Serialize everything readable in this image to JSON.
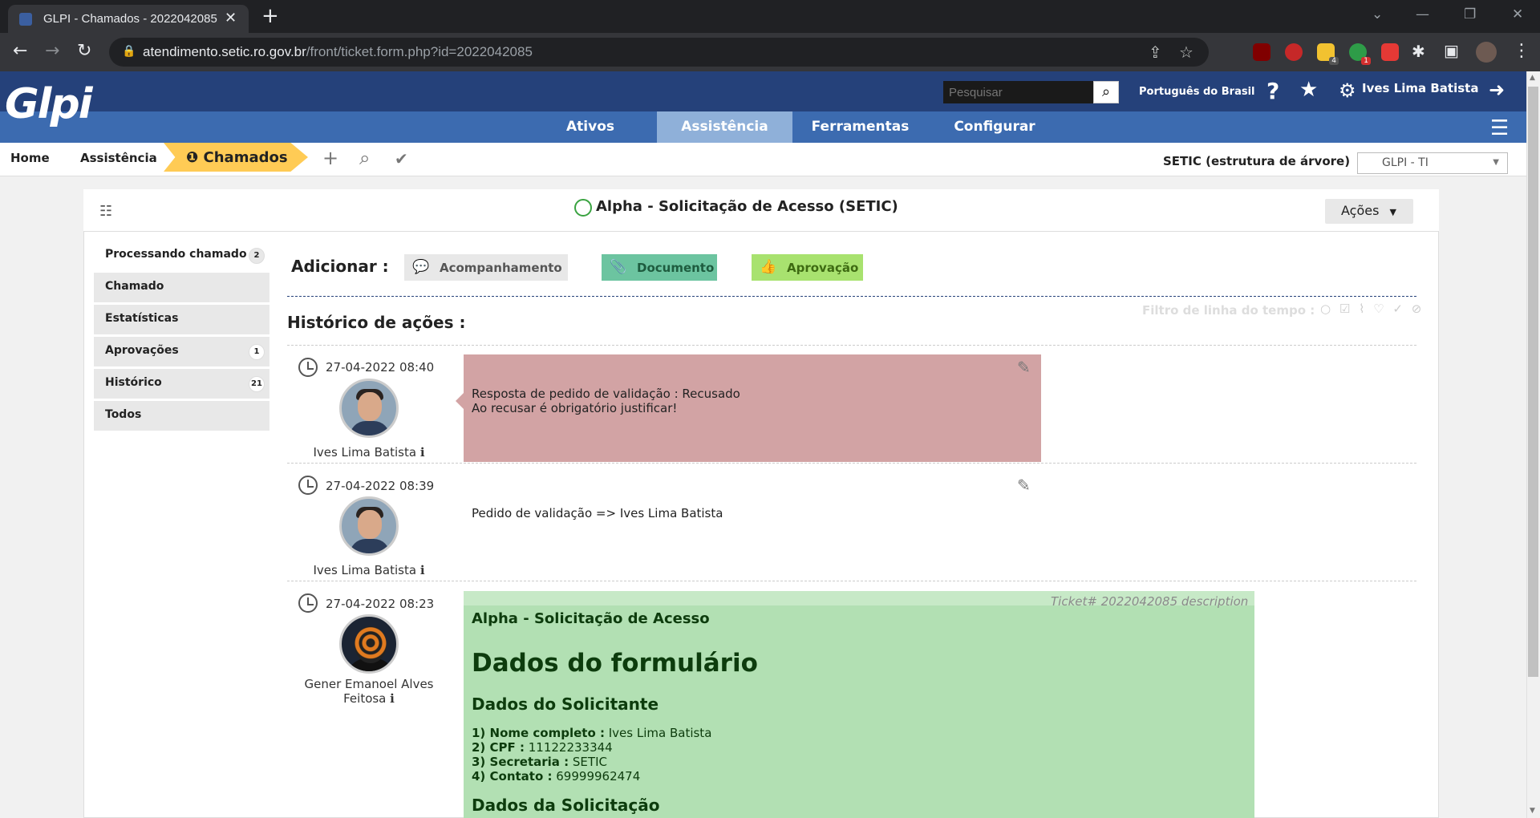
{
  "browser": {
    "tab_title": "GLPI - Chamados - 2022042085",
    "url_host": "atendimento.setic.ro.gov.br",
    "url_path": "/front/ticket.form.php?id=2022042085",
    "ext_badge_1": "4",
    "ext_badge_2": "1"
  },
  "header": {
    "logo": "Glpi",
    "search_placeholder": "Pesquisar",
    "language": "Português do Brasil",
    "user": "Ives Lima Batista"
  },
  "menu": {
    "items": [
      "Ativos",
      "Assistência",
      "Ferramentas",
      "Configurar"
    ],
    "active_index": 1
  },
  "breadcrumb": {
    "home": "Home",
    "section": "Assistência",
    "current": "Chamados",
    "entity_label": "SETIC (estrutura de árvore)",
    "entity_select": "GLPI - TI"
  },
  "ticket": {
    "title": "Alpha - Solicitação de Acesso (SETIC)",
    "actions_label": "Ações"
  },
  "side_tabs": [
    {
      "label": "Processando chamado",
      "badge": "2"
    },
    {
      "label": "Chamado",
      "badge": ""
    },
    {
      "label": "Estatísticas",
      "badge": ""
    },
    {
      "label": "Aprovações",
      "badge": "1"
    },
    {
      "label": "Histórico",
      "badge": "21"
    },
    {
      "label": "Todos",
      "badge": ""
    }
  ],
  "add": {
    "label": "Adicionar :",
    "buttons": [
      "Acompanhamento",
      "Documento",
      "Aprovação"
    ]
  },
  "history": {
    "title": "Histórico de ações :",
    "filter_label": "Filtro de linha do tempo :",
    "entries": [
      {
        "time": "27-04-2022 08:40",
        "author": "Ives Lima Batista",
        "lines": [
          "Resposta de pedido de validação : Recusado",
          "Ao recusar é obrigatório justificar!"
        ]
      },
      {
        "time": "27-04-2022 08:39",
        "author": "Ives Lima Batista",
        "lines": [
          "Pedido de validação => Ives Lima Batista"
        ]
      },
      {
        "time": "27-04-2022 08:23",
        "author_line1": "Gener Emanoel Alves",
        "author_line2": "Feitosa",
        "desc_ref": "Ticket# 2022042085 description",
        "heading": "Alpha - Solicitação de Acesso",
        "form_title": "Dados do formulário",
        "section1": "Dados do Solicitante",
        "fields": [
          {
            "label": "1) Nome completo :",
            "value": " Ives Lima Batista"
          },
          {
            "label": "2) CPF :",
            "value": " 11122233344"
          },
          {
            "label": "3) Secretaria :",
            "value": " SETIC"
          },
          {
            "label": "4) Contato :",
            "value": " 69999962474"
          }
        ],
        "section2": "Dados da Solicitação"
      }
    ]
  },
  "colors": {
    "header_dark": "#25417a",
    "menu_blue": "#3c6bb0",
    "crumb_active": "#ffcb55",
    "refused_bubble": "#d2a3a4",
    "description_bubble": "#b2e0b3"
  }
}
